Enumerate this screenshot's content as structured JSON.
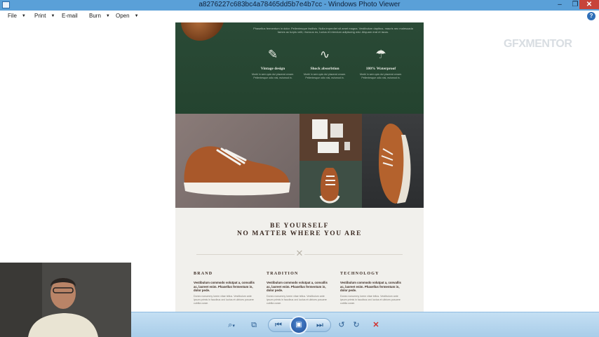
{
  "window": {
    "title": "a8276227c683bc4a78465dd5b7e4b7cc - Windows Photo Viewer",
    "minimize_glyph": "–",
    "maximize_glyph": "❐",
    "close_glyph": "✕"
  },
  "menu": {
    "file": "File",
    "print": "Print",
    "email": "E-mail",
    "burn": "Burn",
    "open": "Open",
    "help_glyph": "?"
  },
  "overlay": {
    "brand": "GFXMENTOR"
  },
  "webpage": {
    "intro": "Phasellus fermentum in dolor. Pellentesque facilisis. Nulla imperdiet sit amet magna. Vestibulum dapibus, mauris nec malesuada fames ac turpis velit, rhoncus eu, luctus et interdum adipiscing wisi. Aliquam erat et lacus.",
    "features": [
      {
        "icon": "✎",
        "title": "Vintage design",
        "text": "Morbi in sem quis dui placerat ornare. Pellentesque odio nisi, euismod in."
      },
      {
        "icon": "∿",
        "title": "Shock absorbtion",
        "text": "Morbi in sem quis dui placerat ornare. Pellentesque odio nisi, euismod in."
      },
      {
        "icon": "☂",
        "title": "100% Waterproof",
        "text": "Morbi in sem quis dui placerat ornare. Pellentesque odio nisi, euismod in."
      }
    ],
    "headline_1": "BE YOURSELF",
    "headline_2": "NO MATTER WHERE YOU ARE",
    "divider_mark": "✕",
    "columns": [
      {
        "title": "BRAND",
        "subtitle": "Vestibulum commodo volutpat a, convallis ac, laoreet enim. Phasellus fermentum in, dolor pede.",
        "text": "Donec nonummy lorem vitae tellus. Vestibulum ante ipsum primis in faucibus orci luctus et ultrices posuere cubilia curae."
      },
      {
        "title": "TRADITION",
        "subtitle": "Vestibulum commodo volutpat a, convallis ac, laoreet enim. Phasellus fermentum in, dolor pede.",
        "text": "Donec nonummy lorem vitae tellus. Vestibulum ante ipsum primis in faucibus orci luctus et ultrices posuere cubilia curae."
      },
      {
        "title": "TECHNOLOGY",
        "subtitle": "Vestibulum commodo volutpat a, convallis ac, laoreet enim. Phasellus fermentum in, dolor pede.",
        "text": "Donec nonummy lorem vitae tellus. Vestibulum ante ipsum primis in faucibus orci luctus et ultrices posuere cubilia curae."
      }
    ]
  },
  "toolbar": {
    "zoom_glyph": "⌕",
    "zoom_caret": "▾",
    "fit_glyph": "⧉",
    "previous_glyph": "⏮",
    "slideshow_glyph": "▣",
    "next_glyph": "⏭",
    "rotate_ccw_glyph": "↺",
    "rotate_cw_glyph": "↻",
    "delete_glyph": "✕"
  },
  "colors": {
    "titlebar": "#5aa0d8",
    "toolbar": "#b6d6ee",
    "page_green": "#24432f",
    "page_cream": "#f1f0ec",
    "delete_red": "#d2302c"
  }
}
